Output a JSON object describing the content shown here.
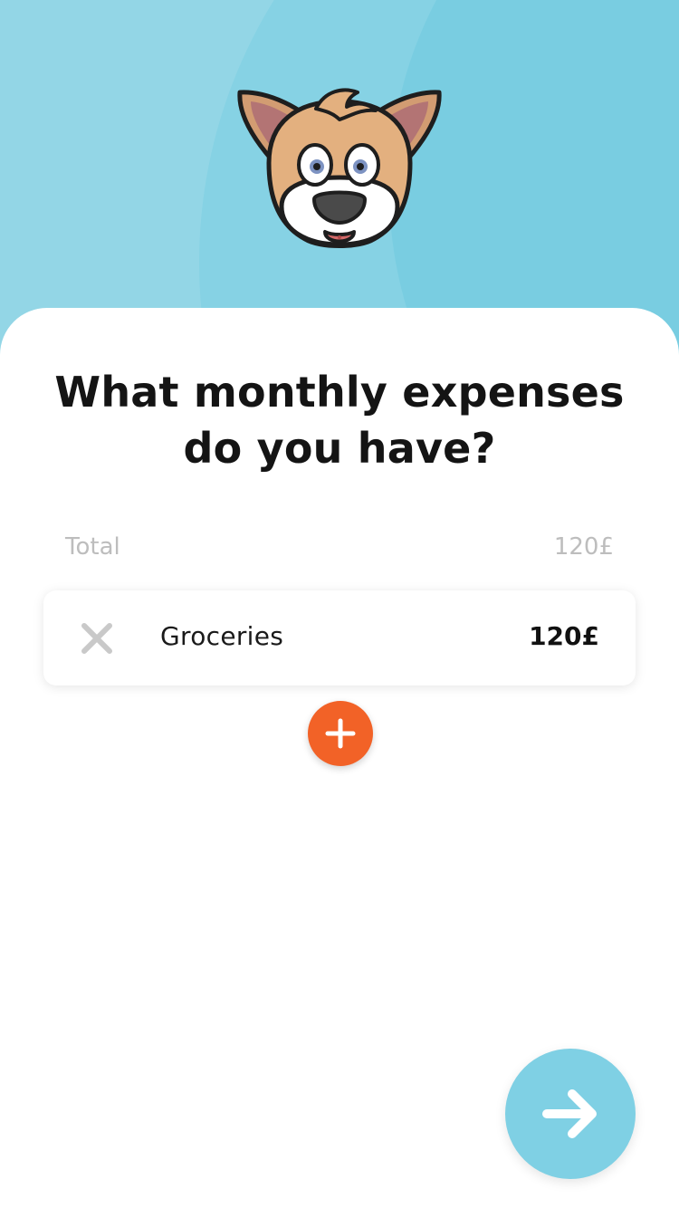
{
  "screen": {
    "question": "What monthly expenses do you have?"
  },
  "summary": {
    "total_label": "Total",
    "total_value": "120£"
  },
  "expenses": [
    {
      "name": "Groceries",
      "amount": "120£"
    }
  ],
  "icons": {
    "mascot": "dog-mascot-icon",
    "remove": "close-icon",
    "add": "plus-icon",
    "next": "arrow-right-icon"
  },
  "colors": {
    "hero_background": "#93d6e6",
    "add_button": "#f26227",
    "next_button": "#7fd0e4",
    "muted_text": "#bdbdbd"
  }
}
